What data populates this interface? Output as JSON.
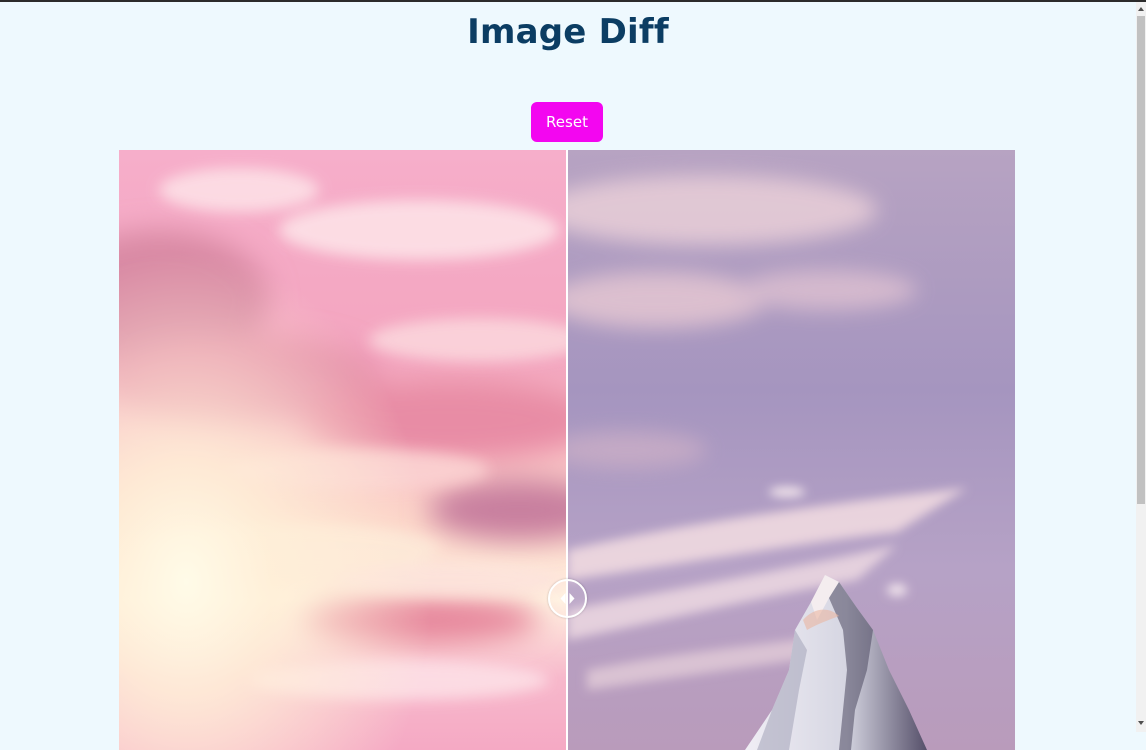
{
  "header": {
    "title": "Image Diff"
  },
  "toolbar": {
    "reset_label": "Reset"
  },
  "comparison": {
    "split_position": 0.5
  },
  "icons": {
    "handle": "left-right-arrows-icon",
    "scroll_up": "chevron-up-icon",
    "scroll_down": "chevron-down-icon"
  },
  "colors": {
    "background": "#eef9fe",
    "title": "#0b3d63",
    "accent": "#f306f0",
    "divider": "#ffffff"
  }
}
